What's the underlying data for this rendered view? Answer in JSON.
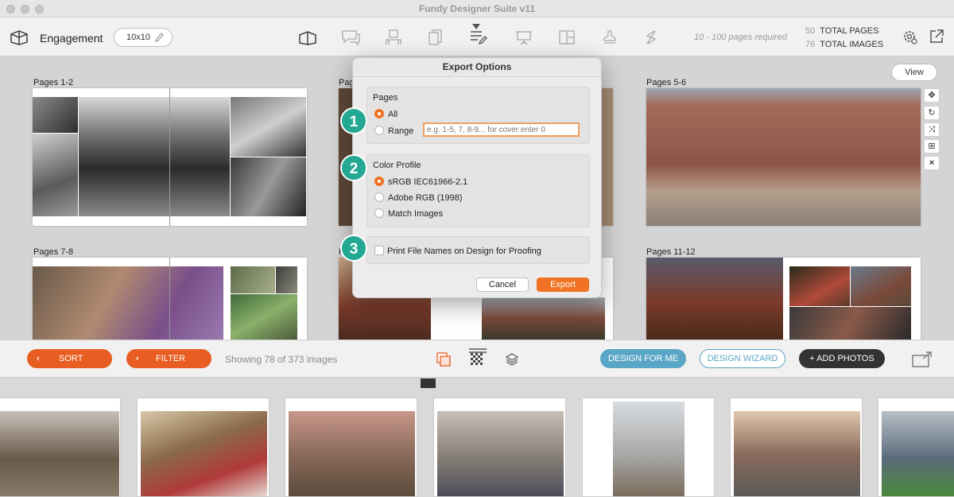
{
  "window": {
    "title": "Fundy Designer Suite v11"
  },
  "toolbar": {
    "album_name": "Engagement",
    "album_size": "10x10",
    "pages_required": "10 - 100 pages required",
    "total_pages_count": "50",
    "total_pages_label": "TOTAL PAGES",
    "total_images_count": "76",
    "total_images_label": "TOTAL IMAGES",
    "icons": [
      "album-icon",
      "proofing-chat-icon",
      "wall-art-icon",
      "card-icon",
      "design-tools-icon",
      "presentation-icon",
      "layout-icon",
      "stamp-icon",
      "slideshow-icon"
    ]
  },
  "main": {
    "view_label": "View",
    "spreads": [
      {
        "label": "Pages 1-2"
      },
      {
        "label": "Pag"
      },
      {
        "label": "Pages 5-6"
      },
      {
        "label": "Pages 7-8"
      },
      {
        "label": "Pag"
      },
      {
        "label": "Pages 11-12"
      }
    ],
    "side_tools": [
      "move-icon",
      "rotate-icon",
      "shuffle-icon",
      "grid-icon",
      "close-icon"
    ]
  },
  "dialog": {
    "title": "Export Options",
    "pages_group_title": "Pages",
    "pages_options": [
      "All",
      "Range"
    ],
    "pages_selected": "All",
    "range_placeholder": "e.g. 1-5, 7, 8-9... for cover enter 0",
    "range_value": "",
    "color_group_title": "Color Profile",
    "color_options": [
      "sRGB IEC61966-2.1",
      "Adobe RGB (1998)",
      "Match Images"
    ],
    "color_selected": "sRGB IEC61966-2.1",
    "print_names_label": "Print File Names on Design for Proofing",
    "print_names_checked": false,
    "cancel_label": "Cancel",
    "export_label": "Export",
    "step_badges": [
      "1",
      "2",
      "3"
    ]
  },
  "bottombar": {
    "sort_label": "SORT",
    "filter_label": "FILTER",
    "showing_text": "Showing 78 of 373 images",
    "design_for_me_label": "DESIGN FOR ME",
    "design_wizard_label": "DESIGN WIZARD",
    "add_photos_label": "+ ADD PHOTOS"
  },
  "colors": {
    "accent": "#e85d22",
    "teal_badge": "#23a893",
    "blue_button": "#5aa6c6"
  }
}
